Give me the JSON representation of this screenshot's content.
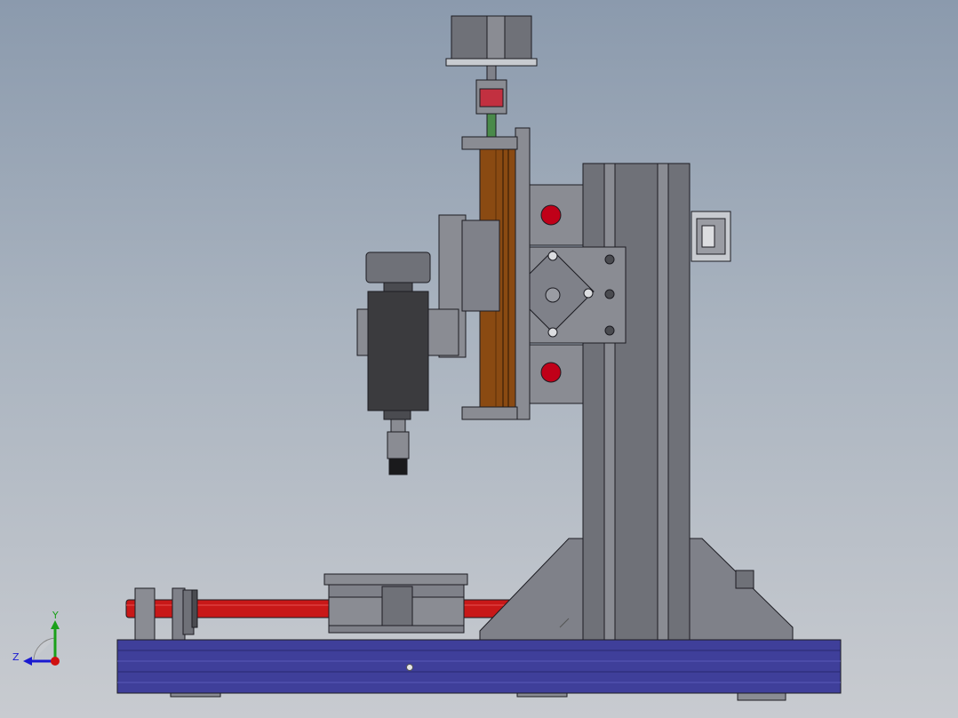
{
  "colors": {
    "background_top": "#8b9aad",
    "background_bottom": "#c8cbd0",
    "frame_gray": "#6f7178",
    "frame_light": "#8a8c93",
    "plate_gray": "#7f8189",
    "motor_dark": "#3b3b3e",
    "wood_orange": "#8a4a12",
    "base_blue": "#3f3f9a",
    "rod_red": "#c81818",
    "bearing_red": "#c00018",
    "outline": "#1c1c22"
  },
  "triad": {
    "x_label": "",
    "y_label": "Y",
    "z_label": "Z",
    "y_color": "#1aa01a",
    "z_color": "#1a1ad0",
    "origin_color": "#d01010"
  }
}
